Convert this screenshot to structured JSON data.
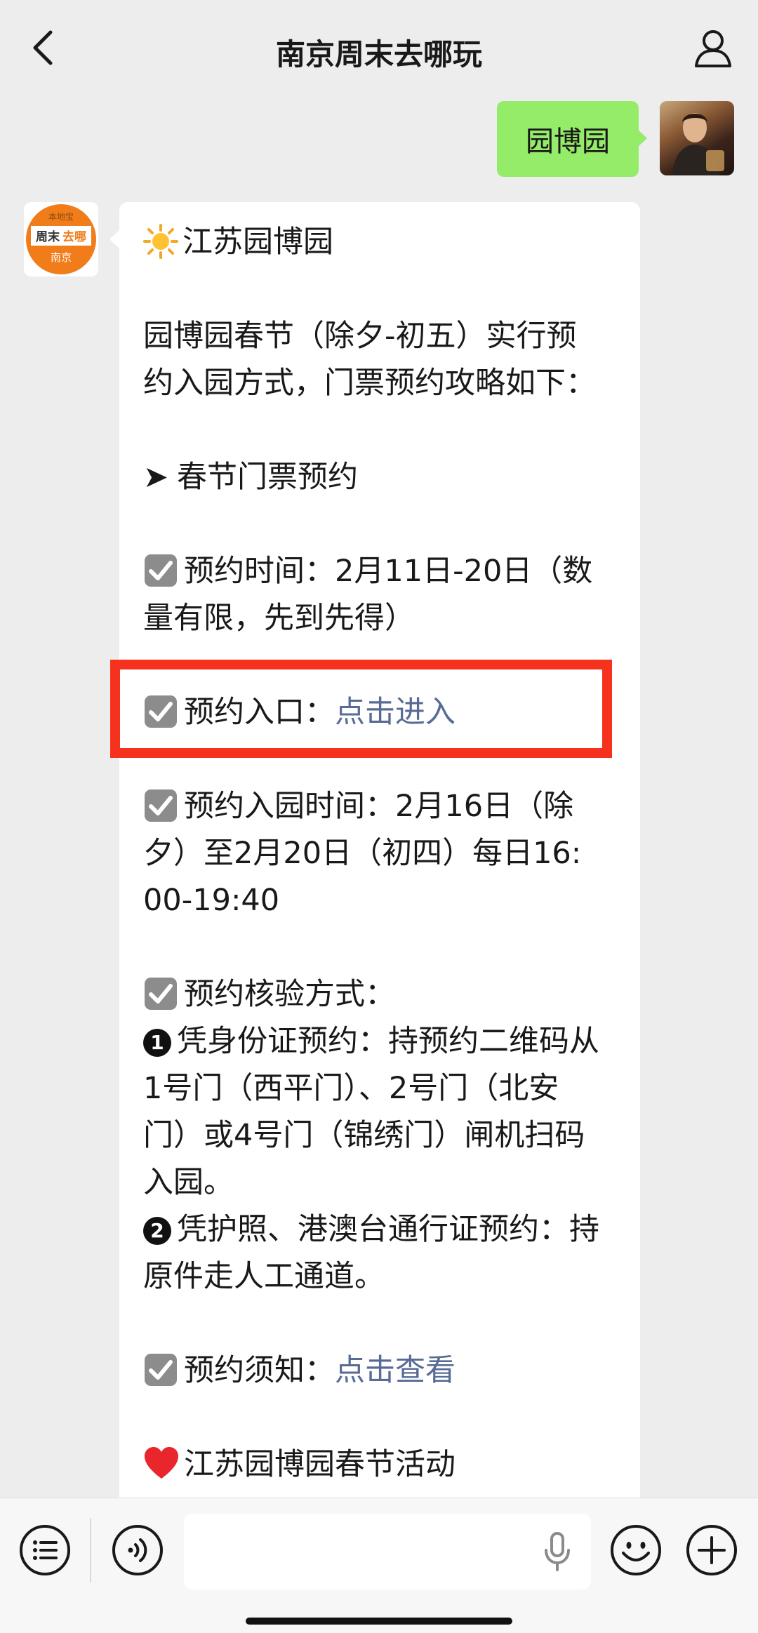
{
  "header": {
    "title": "南京周末去哪玩",
    "back_icon": "chevron-left-icon",
    "profile_icon": "person-icon"
  },
  "sent": {
    "text": "园博园"
  },
  "sender_logo": {
    "top_text": "本地宝",
    "brand_a": "周末",
    "brand_b": "去哪",
    "city": "南京",
    "accent_color": "#f07c1a"
  },
  "message": {
    "heading": "江苏园博园",
    "intro_1": "园博园春节（除夕-初五）实行预",
    "intro_2": "约入园方式，门票预约攻略如下：",
    "arrow_symbol": "➤",
    "section1": "春节门票预约",
    "booking_time_1": "预约时间：2月11日-20日（数",
    "booking_time_2": "量有限，先到先得）",
    "entrance_label": "预约入口：",
    "entrance_link": "点击进入",
    "entry_time_1": "预约入园时间：2月16日（除",
    "entry_time_2": "夕）至2月20日（初四）每日16:",
    "entry_time_3": "00-19:40",
    "verify_title": "预约核验方式：",
    "num1": "1",
    "verify_1a": "凭身份证预约：持预约二维码从",
    "verify_1b": "1号门（西平门）、2号门（北安",
    "verify_1c": "门）或4号门（锦绣门）闸机扫码",
    "verify_1d": "入园。",
    "num2": "2",
    "verify_2a": "凭护照、港澳台通行证预约：持",
    "verify_2b": "原件走人工通道。",
    "notice_label": "预约须知：",
    "notice_link": "点击查看",
    "activity": "江苏园博园春节活动",
    "link_color": "#576b95",
    "highlight_color": "#f5321d"
  },
  "input_bar": {
    "list_icon": "list-icon",
    "voice_icon": "voice-icon",
    "mic_icon": "microphone-icon",
    "emoji_icon": "emoji-icon",
    "plus_icon": "plus-icon"
  }
}
